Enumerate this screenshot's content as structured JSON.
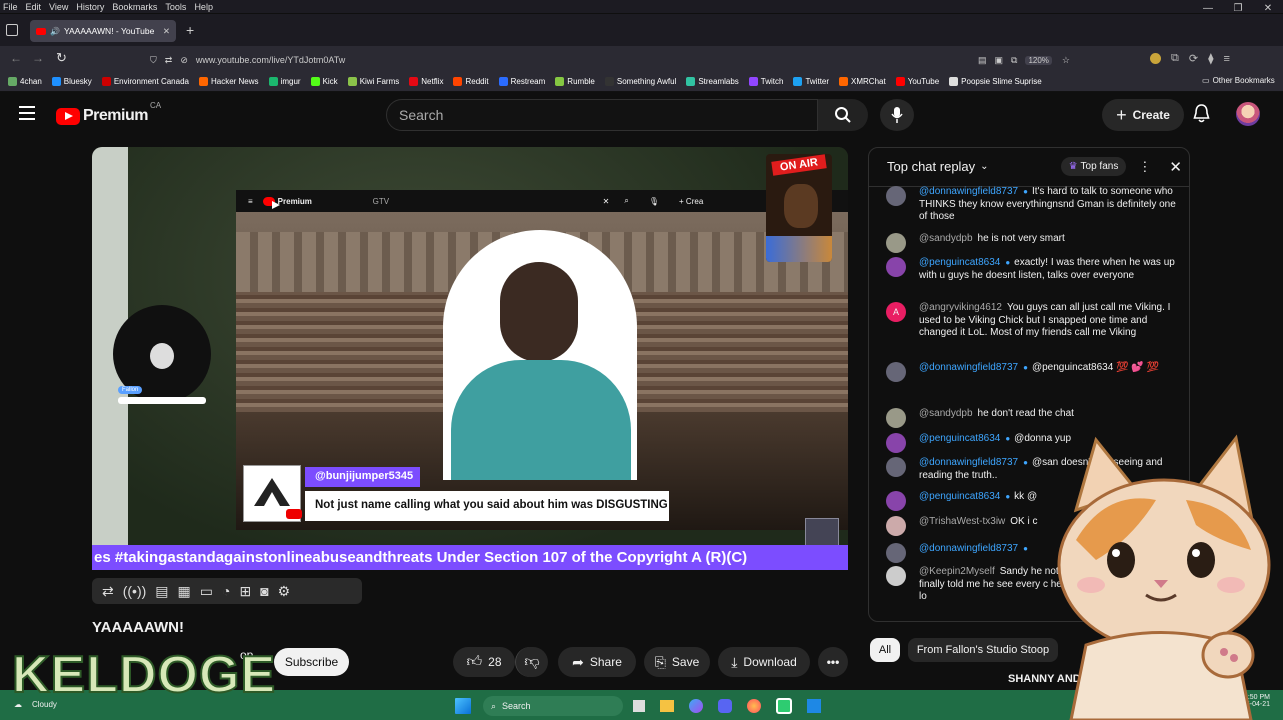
{
  "browser": {
    "menu": [
      "File",
      "Edit",
      "View",
      "History",
      "Bookmarks",
      "Tools",
      "Help"
    ],
    "tab_title": "YAAAAAWN! - YouTube",
    "url": "www.youtube.com/live/YTdJotm0ATw",
    "zoom": "120%",
    "bookmarks": [
      {
        "label": "4chan",
        "color": "#6a6"
      },
      {
        "label": "Bluesky",
        "color": "#1e90ff"
      },
      {
        "label": "Environment Canada",
        "color": "#c00"
      },
      {
        "label": "Hacker News",
        "color": "#ff6600"
      },
      {
        "label": "imgur",
        "color": "#1bb76e"
      },
      {
        "label": "Kick",
        "color": "#53fc18"
      },
      {
        "label": "Kiwi Farms",
        "color": "#8bc34a"
      },
      {
        "label": "Netflix",
        "color": "#e50914"
      },
      {
        "label": "Reddit",
        "color": "#ff4500"
      },
      {
        "label": "Restream",
        "color": "#2b6cff"
      },
      {
        "label": "Rumble",
        "color": "#85c742"
      },
      {
        "label": "Something Awful",
        "color": "#333"
      },
      {
        "label": "Streamlabs",
        "color": "#31c3a2"
      },
      {
        "label": "Twitch",
        "color": "#9146ff"
      },
      {
        "label": "Twitter",
        "color": "#1da1f2"
      },
      {
        "label": "XMRChat",
        "color": "#f60"
      },
      {
        "label": "YouTube",
        "color": "#f00"
      },
      {
        "label": "Poopsie Slime Suprise",
        "color": "#ddd"
      }
    ],
    "other_bookmarks": "Other Bookmarks"
  },
  "header": {
    "logo": "Premium",
    "region": "CA",
    "search_placeholder": "Search",
    "create_label": "Create"
  },
  "video": {
    "inner_logo": "Premium",
    "inner_search": "GTV",
    "inner_create": "Crea",
    "on_air": "ON AIR",
    "name_tag": "Fallon",
    "chat_user": "@bunjijumper5345",
    "chat_text": "Not just name calling what you said about him was DISGUSTING",
    "ticker": "es #takingastandagainstonlineabuseandthreats Under Section 107 of the Copyright A (R)(C)"
  },
  "below": {
    "title": "YAAAAAWN!",
    "channel_partial": "op",
    "subscribe": "Subscribe",
    "likes": "28",
    "share": "Share",
    "save": "Save",
    "download": "Download"
  },
  "chat": {
    "header": "Top chat replay",
    "top_fans": "Top fans",
    "messages": [
      {
        "author": "@donnawingfield8737",
        "member": true,
        "text": "It's hard to talk to someone who THINKS they know everythingnsnd Gman is definitely one of those",
        "av": "#667"
      },
      {
        "author": "@sandydpb",
        "member": false,
        "text": "he is not very smart",
        "av": "#998"
      },
      {
        "author": "@penguincat8634",
        "member": true,
        "text": "exactly! I was there when he was up with u guys he doesnt listen, talks over everyone",
        "av": "#84a"
      },
      {
        "author": "@angryviking4612",
        "member": false,
        "text": "You guys can all just call me Viking. I used to be Viking Chick but I snapped one time and changed it LoL. Most of my friends call me Viking",
        "av": "#e91e63",
        "initial": "A"
      },
      {
        "author": "@donnawingfield8737",
        "member": true,
        "text": "@penguincat8634 💯 💕 💯",
        "av": "#667"
      },
      {
        "author": "@sandydpb",
        "member": false,
        "text": "he don't read the chat",
        "av": "#998"
      },
      {
        "author": "@penguincat8634",
        "member": true,
        "text": "@donna yup",
        "av": "#84a"
      },
      {
        "author": "@donnawingfield8737",
        "member": true,
        "text": "@san doesn't like seeing and reading the truth..",
        "av": "#667"
      },
      {
        "author": "@penguincat8634",
        "member": true,
        "text": "kk @",
        "av": "#84a"
      },
      {
        "author": "@TrishaWest-tx3iw",
        "member": false,
        "text": "OK i c",
        "av": "#caa"
      },
      {
        "author": "@donnawingfield8737",
        "member": true,
        "text": "",
        "av": "#667"
      },
      {
        "author": "@Keepin2Myself",
        "member": false,
        "text": "Sandy he not ever reading my comme finally told me he see every c he still never addressed any lo",
        "av": "#ccc"
      }
    ],
    "chips": [
      "All",
      "From Fallon's Studio Stoop"
    ],
    "shanny": "SHANNY AND F"
  },
  "overlay": {
    "brand": "KELDOGE"
  },
  "taskbar": {
    "weather": "Cloudy",
    "search": "Search",
    "time": "2:50 PM",
    "date": "2026-04-21"
  }
}
